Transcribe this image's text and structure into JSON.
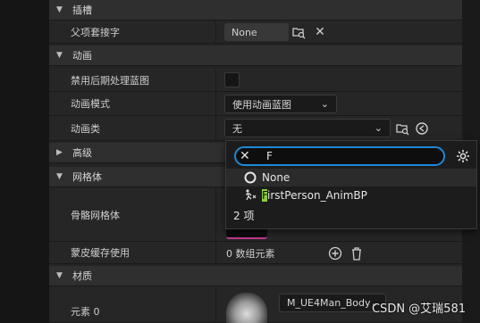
{
  "sections": {
    "socket": {
      "title": "插槽",
      "parent_socket": {
        "label": "父项套接字",
        "value": "None"
      }
    },
    "animation": {
      "title": "动画",
      "disable_post_process": {
        "label": "禁用后期处理蓝图"
      },
      "anim_mode": {
        "label": "动画模式",
        "value": "使用动画蓝图"
      },
      "anim_class": {
        "label": "动画类",
        "value": "无"
      }
    },
    "advanced": {
      "title": "高级"
    },
    "mesh": {
      "title": "网格体",
      "skeletal_mesh": {
        "label": "骨骼网格体"
      },
      "skin_cache": {
        "label": "蒙皮缓存使用",
        "value": "0 数组元素"
      }
    },
    "material": {
      "title": "材质",
      "element0": {
        "label": "元素 0",
        "value": "M_UE4Man_Body"
      }
    }
  },
  "picker": {
    "search_text": "F",
    "options": [
      {
        "label": "None"
      },
      {
        "label_highlight": "F",
        "label_rest": "irstPerson_AnimBP"
      }
    ],
    "count": "2 项"
  },
  "watermark": "CSDN @艾瑞581",
  "colors": {
    "accent": "#1f88d6",
    "highlight": "#8bcf3a"
  },
  "icons": [
    "close-icon",
    "browse-icon",
    "settings-gear-icon",
    "chevron-down-icon",
    "add-icon",
    "trash-icon",
    "anim-bp-icon"
  ]
}
